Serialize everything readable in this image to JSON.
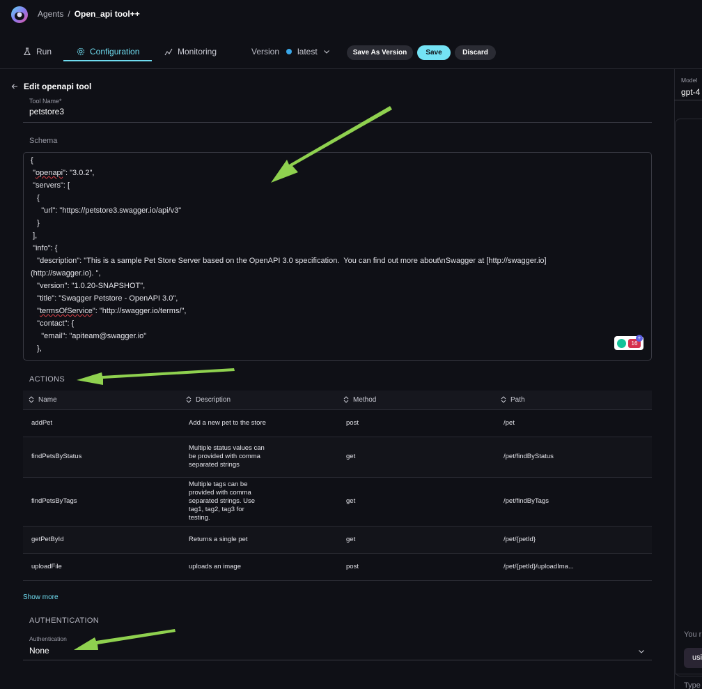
{
  "header": {
    "breadcrumb_root": "Agents",
    "breadcrumb_sep": "/",
    "breadcrumb_current": "Open_api tool++"
  },
  "tabs": [
    {
      "label": "Run",
      "icon": "flask-icon"
    },
    {
      "label": "Configuration",
      "icon": "gear-icon",
      "active": true
    },
    {
      "label": "Monitoring",
      "icon": "monitoring-icon"
    }
  ],
  "version": {
    "label": "Version",
    "value": "latest"
  },
  "buttons": {
    "save_as_version": "Save As Version",
    "save": "Save",
    "discard": "Discard"
  },
  "editor": {
    "back_title": "Edit openapi tool",
    "tool_name_label": "Tool Name*",
    "tool_name_value": "petstore3",
    "schema_label": "Schema",
    "schema_lines": [
      "{",
      " \"openapi\": \"3.0.2\",",
      " \"servers\": [",
      "   {",
      "     \"url\": \"https://petstore3.swagger.io/api/v3\"",
      "   }",
      " ],",
      " \"info\": {",
      "   \"description\": \"This is a sample Pet Store Server based on the OpenAPI 3.0 specification.  You can find out more about\\nSwagger at [http://swagger.io]",
      "(http://swagger.io). \",",
      "   \"version\": \"1.0.20-SNAPSHOT\",",
      "   \"title\": \"Swagger Petstore - OpenAPI 3.0\",",
      "   \"termsOfService\": \"http://swagger.io/terms/\",",
      "   \"contact\": {",
      "     \"email\": \"apiteam@swagger.io\"",
      "   },"
    ],
    "grammarly_count": "16"
  },
  "actions": {
    "title": "ACTIONS",
    "columns": [
      "Name",
      "Description",
      "Method",
      "Path"
    ],
    "rows": [
      {
        "name": "addPet",
        "description": "Add a new pet to the store",
        "method": "post",
        "path": "/pet"
      },
      {
        "name": "findPetsByStatus",
        "description": "Multiple status values can be provided with comma separated strings",
        "method": "get",
        "path": "/pet/findByStatus"
      },
      {
        "name": "findPetsByTags",
        "description": "Multiple tags can be provided with comma separated strings. Use tag1, tag2, tag3 for testing.",
        "method": "get",
        "path": "/pet/findByTags"
      },
      {
        "name": "getPetById",
        "description": "Returns a single pet",
        "method": "get",
        "path": "/pet/{petId}"
      },
      {
        "name": "uploadFile",
        "description": "uploads an image",
        "method": "post",
        "path": "/pet/{petId}/uploadIma..."
      }
    ],
    "show_more": "Show more"
  },
  "authentication": {
    "title": "AUTHENTICATION",
    "field_label": "Authentication",
    "value": "None"
  },
  "right_panel": {
    "model_label": "Model",
    "model_value": "gpt-4",
    "partial_text": "You r",
    "chip_text": "usi",
    "input_placeholder": "Type"
  },
  "colors": {
    "accent": "#6fdcf0",
    "background": "#0f1016",
    "annotation_arrow": "#8fd14f"
  }
}
